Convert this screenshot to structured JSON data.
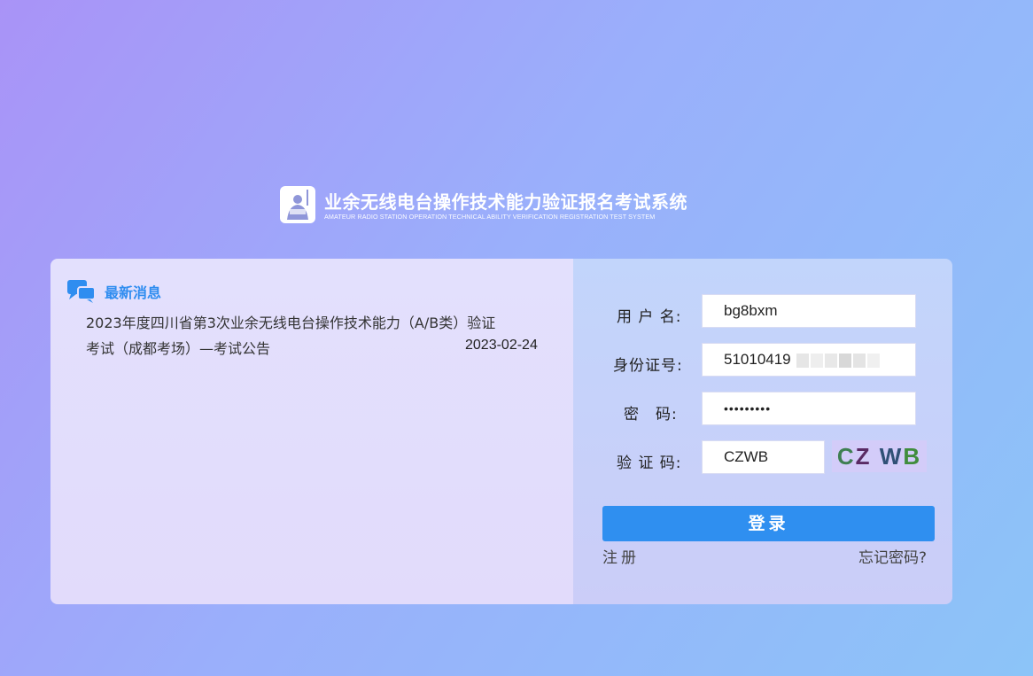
{
  "brand": {
    "title": "业余无线电台操作技术能力验证报名考试系统",
    "subtitle": "AMATEUR RADIO STATION OPERATION TECHNICAL ABILITY VERIFICATION REGISTRATION TEST SYSTEM",
    "logo_icon": "radio-operator-logo-icon"
  },
  "news": {
    "icon": "chat-bubbles-icon",
    "title": "最新消息",
    "items": [
      {
        "text": "2023年度四川省第3次业余无线电台操作技术能力（A/B类）验证考试（成都考场）—考试公告",
        "date": "2023-02-24"
      }
    ]
  },
  "login": {
    "username_label": "用 户 名:",
    "username_value": "bg8bxm",
    "id_label": "身份证号:",
    "id_value_visible": "51010419",
    "password_label": "密　码:",
    "password_value": "•••••••••",
    "captcha_label": "验 证 码:",
    "captcha_value": "CZWB",
    "captcha_image_chars": [
      "C",
      "Z",
      "W",
      "B"
    ],
    "submit_label": "登录",
    "register_link": "注册",
    "forgot_link": "忘记密码?"
  },
  "colors": {
    "accent": "#2f8ff0",
    "news_title": "#2f8df0"
  }
}
